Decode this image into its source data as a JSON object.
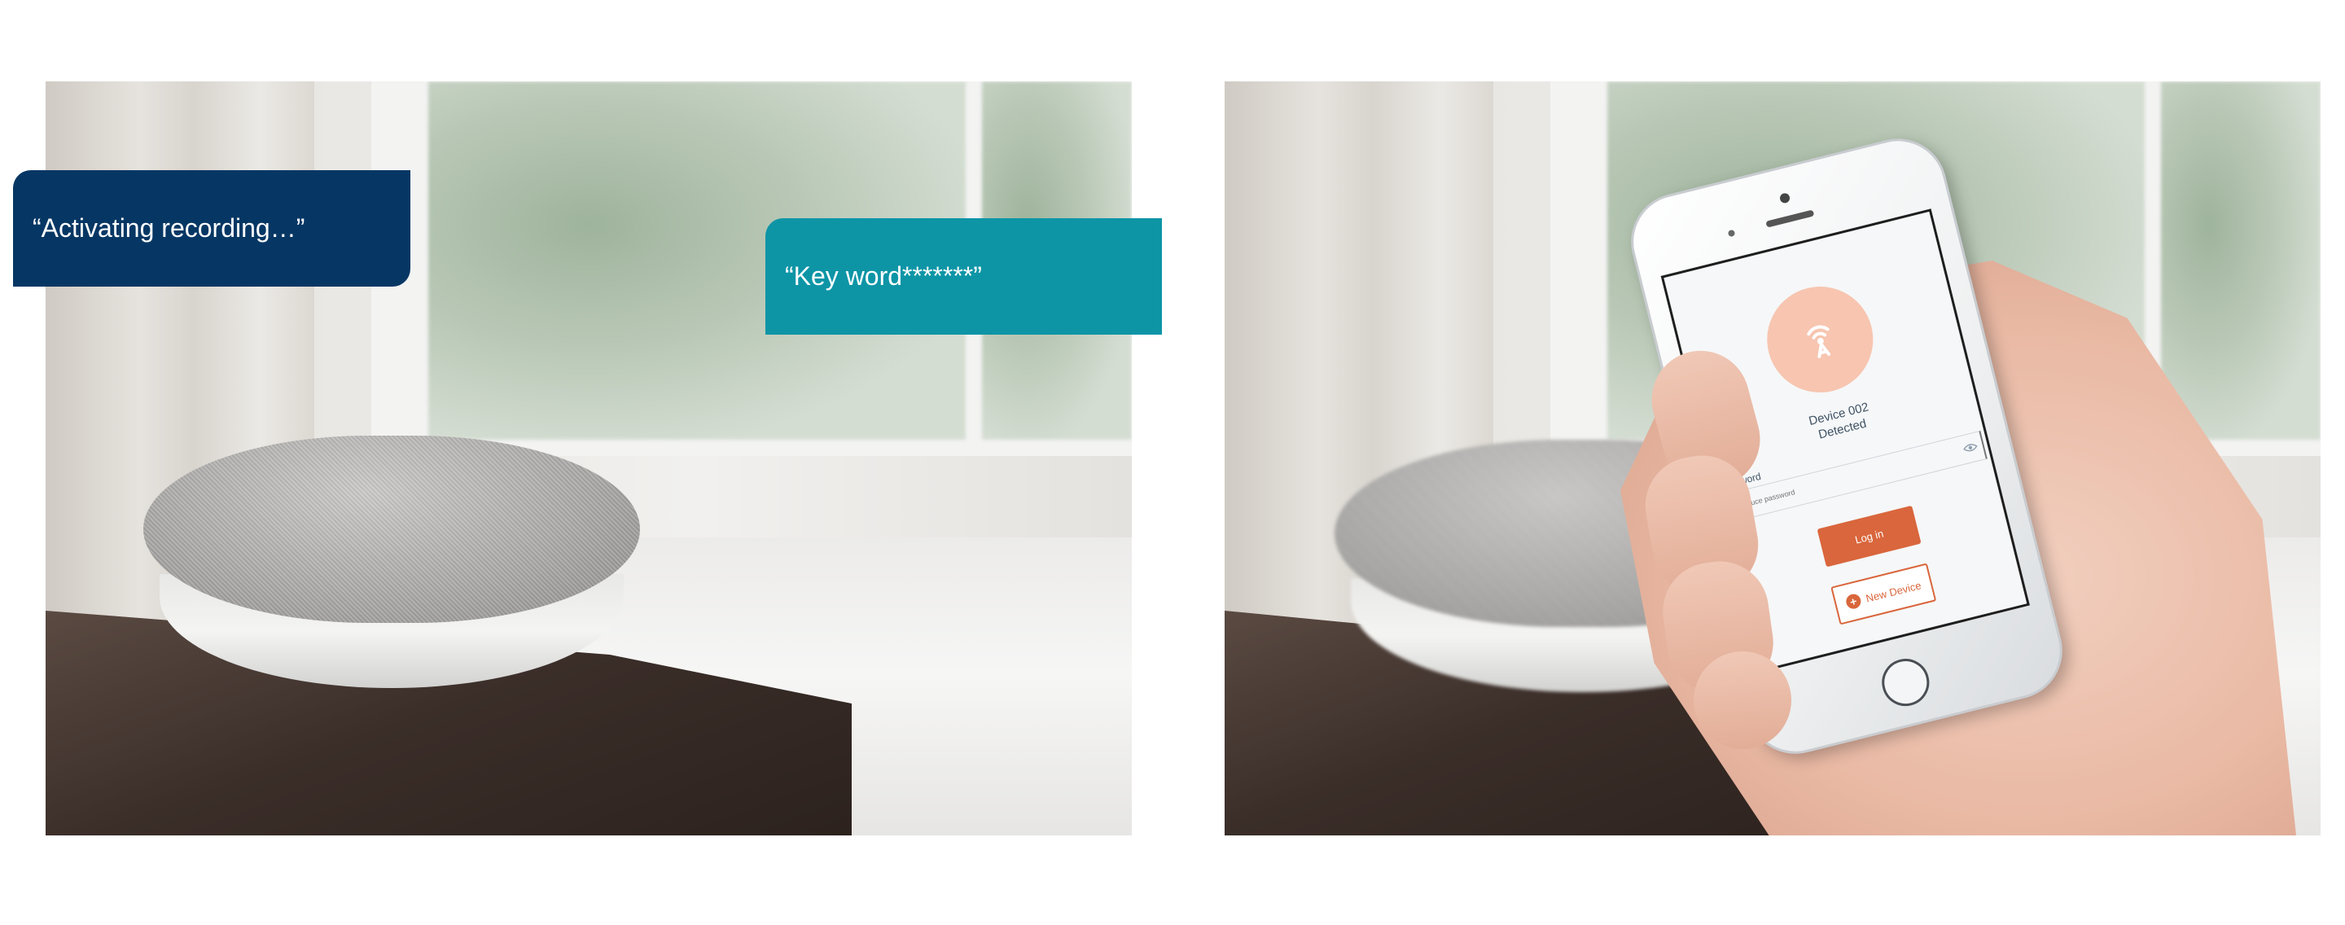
{
  "left_panel": {
    "bubble_activating": "“Activating recording…”",
    "bubble_keyword": "“Key word*******”"
  },
  "phone_app": {
    "device_name": "Device 002",
    "device_status": "Detected",
    "password_label": "Password",
    "password_placeholder": "Introduce password",
    "login_label": "Log in",
    "new_device_label": "New Device",
    "icons": {
      "device": "signal-antenna-icon",
      "reveal_password": "eye-icon",
      "add": "plus-icon"
    }
  },
  "colors": {
    "bubble_navy": "#063764",
    "bubble_teal": "#0d95a6",
    "accent_orange": "#d9663c",
    "device_circle": "#f7c5b0"
  }
}
